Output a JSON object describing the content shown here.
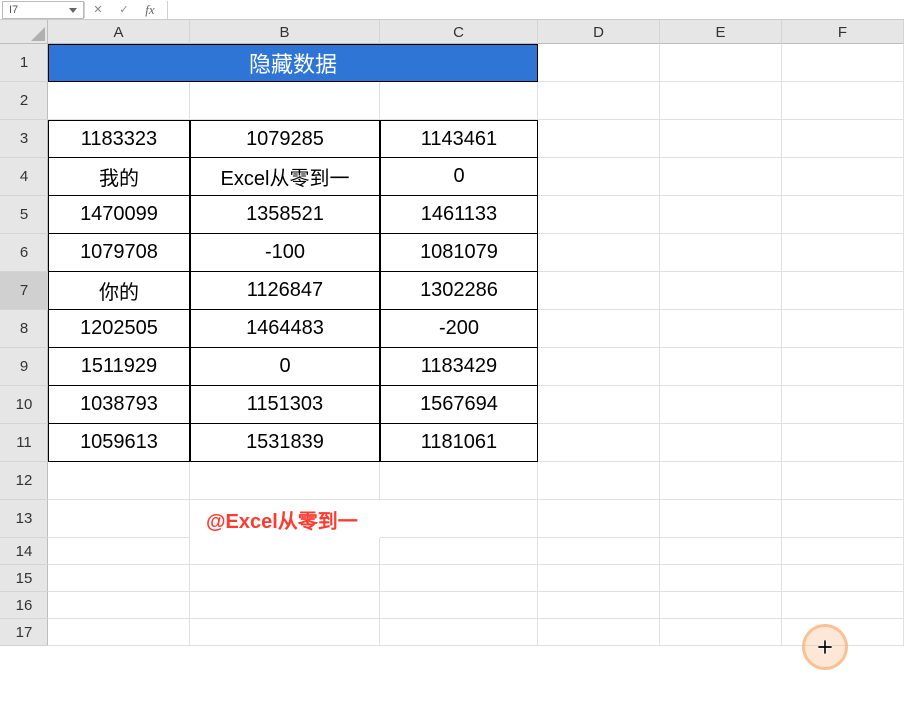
{
  "formula_bar": {
    "name_box_value": "I7",
    "cancel_glyph": "✕",
    "confirm_glyph": "✓",
    "fx_glyph": "fx",
    "formula_value": ""
  },
  "columns": [
    "A",
    "B",
    "C",
    "D",
    "E",
    "F"
  ],
  "row_numbers": [
    "1",
    "2",
    "3",
    "4",
    "5",
    "6",
    "7",
    "8",
    "9",
    "10",
    "11",
    "12",
    "13",
    "14",
    "15",
    "16",
    "17"
  ],
  "active_row": "7",
  "row_heights": {
    "big": [
      "1",
      "2",
      "3",
      "4",
      "5",
      "6",
      "7",
      "8",
      "9",
      "10",
      "11",
      "12",
      "13"
    ],
    "small": [
      "14",
      "15",
      "16",
      "17"
    ]
  },
  "title": "隐藏数据",
  "data_rows": [
    {
      "A": "1183323",
      "B": "1079285",
      "C": "1143461"
    },
    {
      "A": "我的",
      "B": "Excel从零到一",
      "C": "0"
    },
    {
      "A": "1470099",
      "B": "1358521",
      "C": "1461133"
    },
    {
      "A": "1079708",
      "B": "-100",
      "C": "1081079"
    },
    {
      "A": "你的",
      "B": "1126847",
      "C": "1302286"
    },
    {
      "A": "1202505",
      "B": "1464483",
      "C": "-200"
    },
    {
      "A": "1511929",
      "B": "0",
      "C": "1183429"
    },
    {
      "A": "1038793",
      "B": "1151303",
      "C": "1567694"
    },
    {
      "A": "1059613",
      "B": "1531839",
      "C": "1181061"
    }
  ],
  "watermark": "@Excel从零到一"
}
